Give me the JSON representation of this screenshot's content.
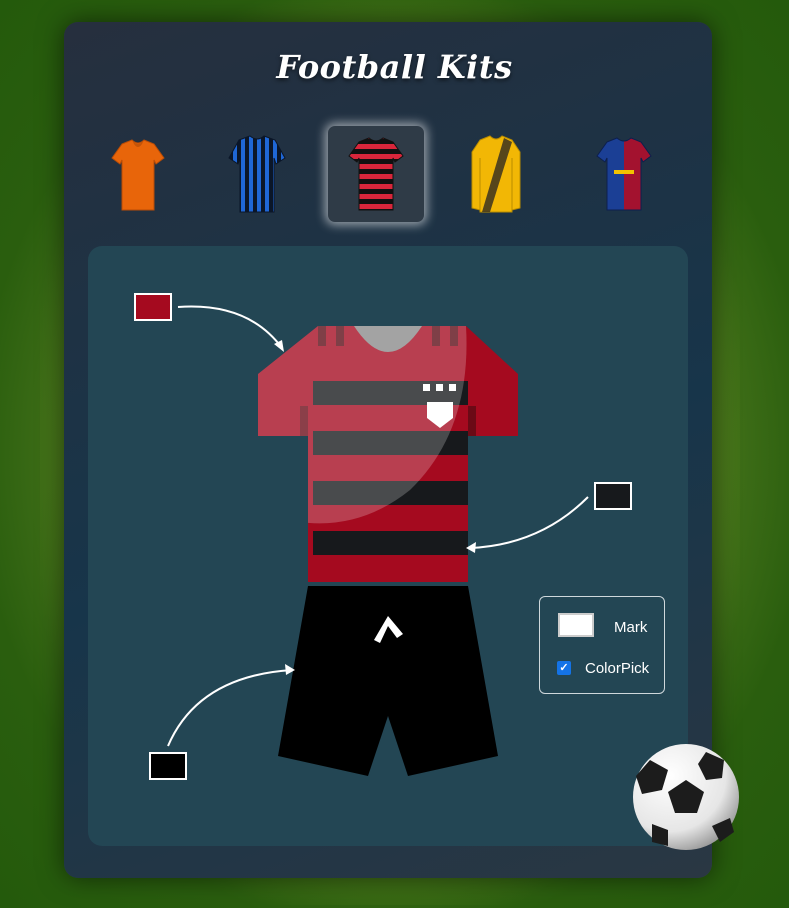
{
  "app": {
    "title": "Football Kits"
  },
  "kits": [
    {
      "name": "orange-kit",
      "selected": false
    },
    {
      "name": "blue-striped-kit",
      "selected": false
    },
    {
      "name": "red-black-hooped-kit",
      "selected": true
    },
    {
      "name": "yellow-sash-kit",
      "selected": false
    },
    {
      "name": "blaugrana-kit",
      "selected": false
    }
  ],
  "editor": {
    "shirt_color": "#a50a1f",
    "stripe_color": "#17191c",
    "shorts_color": "#000000",
    "legend": {
      "mark_label": "Mark",
      "colorpick_label": "ColorPick",
      "colorpick_checked": true
    }
  },
  "icons": {
    "ball": "soccer-ball-icon",
    "checkbox": "checkbox-checked-icon"
  }
}
